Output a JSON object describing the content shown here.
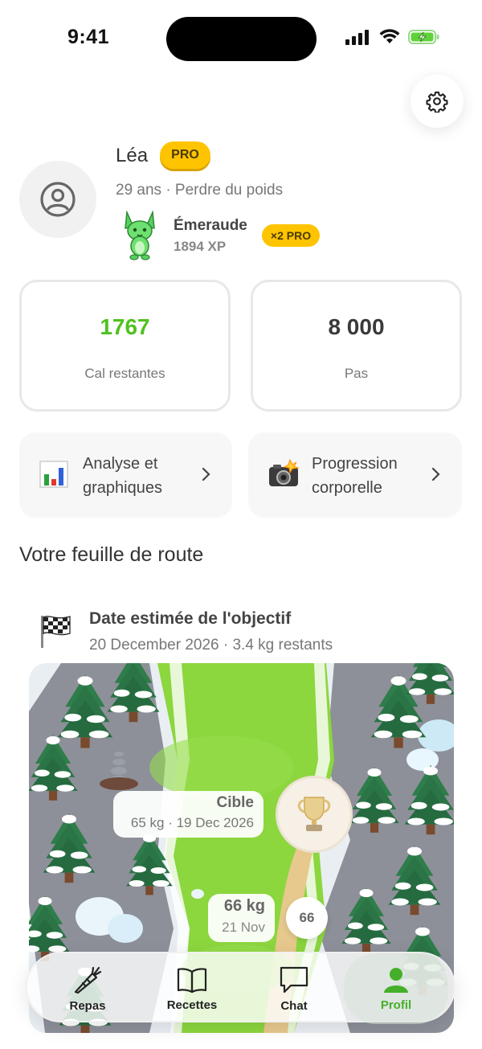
{
  "status_bar": {
    "time": "9:41"
  },
  "profile": {
    "name": "Léa",
    "badge": "PRO",
    "subtitle": "29 ans · Perdre du poids",
    "level_name": "Émeraude",
    "xp": "1894 XP",
    "xp_multiplier": "×2 PRO"
  },
  "stats": [
    {
      "value": "1767",
      "label": "Cal restantes",
      "color": "#4fc21e"
    },
    {
      "value": "8 000",
      "label": "Pas",
      "color": "#3a3a3a"
    }
  ],
  "links": [
    {
      "label": "Analyse et graphiques",
      "icon": "bar-chart-icon"
    },
    {
      "label": "Progression corporelle",
      "icon": "camera-flash-icon"
    }
  ],
  "roadmap": {
    "title": "Votre feuille de route",
    "goal_title": "Date estimée de l'objectif",
    "goal_subtitle": "20 December 2026 · 3.4 kg restants",
    "target_label": "Cible",
    "target_detail": "65 kg · 19 Dec 2026",
    "current_weight": "66 kg",
    "current_date": "21 Nov",
    "next_node": "66"
  },
  "nav": [
    {
      "label": "Repas",
      "icon": "carrot-icon"
    },
    {
      "label": "Recettes",
      "icon": "book-icon"
    },
    {
      "label": "Chat",
      "icon": "chat-bubble-icon"
    },
    {
      "label": "Profil",
      "icon": "person-icon",
      "active": true
    }
  ],
  "colors": {
    "accent_green": "#44b02a",
    "pro_yellow": "#ffc400"
  }
}
